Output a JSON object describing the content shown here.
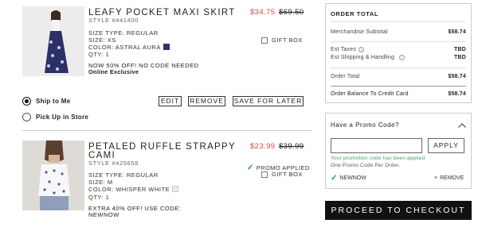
{
  "items": [
    {
      "name": "LEAFY POCKET MAXI SKIRT",
      "style": "STYLE #441400",
      "size_type": "SIZE TYPE: REGULAR",
      "size": "SIZE: XS",
      "color": "COLOR: ASTRAL AURA",
      "color_swatch": "#2d3566",
      "qty": "QTY: 1",
      "promo_line1": "NOW 50% OFF! NO CODE NEEDED",
      "promo_line2": "Online Exclusive",
      "sale_price": "$34.75",
      "orig_price": "$69.50",
      "gift_box": "GIFT BOX",
      "gift_checked": false
    },
    {
      "name_line1": "PETALED RUFFLE STRAPPY",
      "name_line2": "CAMI",
      "style": "STYLE #425658",
      "size_type": "SIZE TYPE: REGULAR",
      "size": "SIZE: M",
      "color": "COLOR: WHISPER WHITE",
      "color_swatch": "#efeadb",
      "qty": "QTY: 1",
      "promo_line1": "EXTRA 40% OFF! USE CODE:",
      "promo_line2": "NEWNOW",
      "sale_price": "$23.99",
      "orig_price": "$39.99",
      "promo_applied": "PROMO APPLIED",
      "gift_box": "GIFT BOX",
      "gift_checked": false
    }
  ],
  "shipping": {
    "ship_to_me": "Ship to Me",
    "pick_up": "Pick Up in Store",
    "selected": "ship_to_me"
  },
  "actions": {
    "edit": "EDIT",
    "remove": "REMOVE",
    "save_for_later": "SAVE FOR LATER"
  },
  "order_total": {
    "title": "ORDER TOTAL",
    "merch_label": "Merchandise Subtotal",
    "merch_value": "$58.74",
    "taxes_label": "Est Taxes",
    "taxes_value": "TBD",
    "shipping_label": "Est Shipping & Handling",
    "shipping_value": "TBD",
    "order_label": "Order Total",
    "order_value": "$58.74",
    "balance_label": "Order Balance To Credit Card",
    "balance_value": "$58.74"
  },
  "promo": {
    "title": "Have a Promo Code?",
    "input_value": "",
    "apply": "APPLY",
    "success": "Your promotion code has been applied",
    "note": "One Promo Code Per Order.",
    "code": "NEWNOW",
    "remove": "REMOVE"
  },
  "checkout": "PROCEED TO CHECKOUT",
  "colors": {
    "sale_red": "#e0463f",
    "success_green": "#3aa35a",
    "checkout_bg": "#111111"
  }
}
